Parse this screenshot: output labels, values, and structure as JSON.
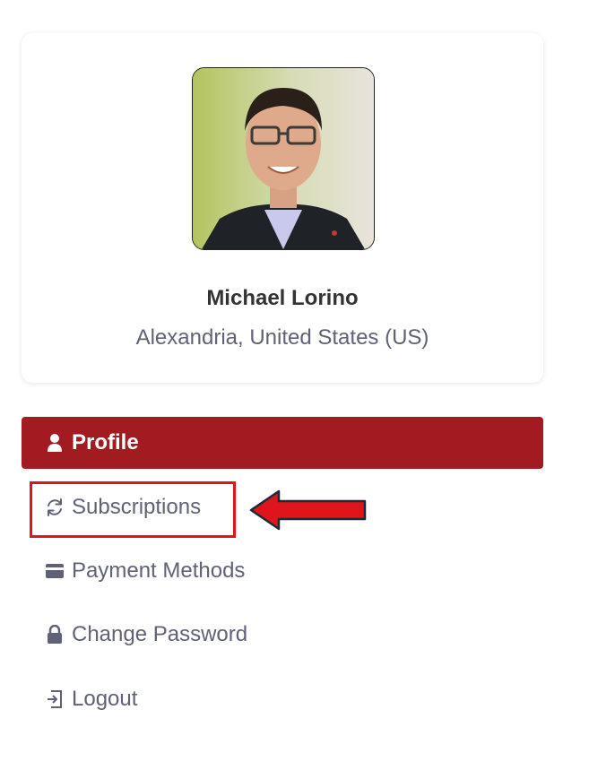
{
  "profile": {
    "name": "Michael Lorino",
    "location": "Alexandria, United States (US)"
  },
  "menu": {
    "items": [
      {
        "label": "Profile",
        "icon": "user-icon",
        "active": true
      },
      {
        "label": "Subscriptions",
        "icon": "refresh-icon",
        "active": false
      },
      {
        "label": "Payment Methods",
        "icon": "credit-card-icon",
        "active": false
      },
      {
        "label": "Change Password",
        "icon": "lock-icon",
        "active": false
      },
      {
        "label": "Logout",
        "icon": "logout-icon",
        "active": false
      }
    ]
  },
  "colors": {
    "active_bg": "#a11b20",
    "menu_text": "#5f6277",
    "annotation": "#e0141b"
  }
}
